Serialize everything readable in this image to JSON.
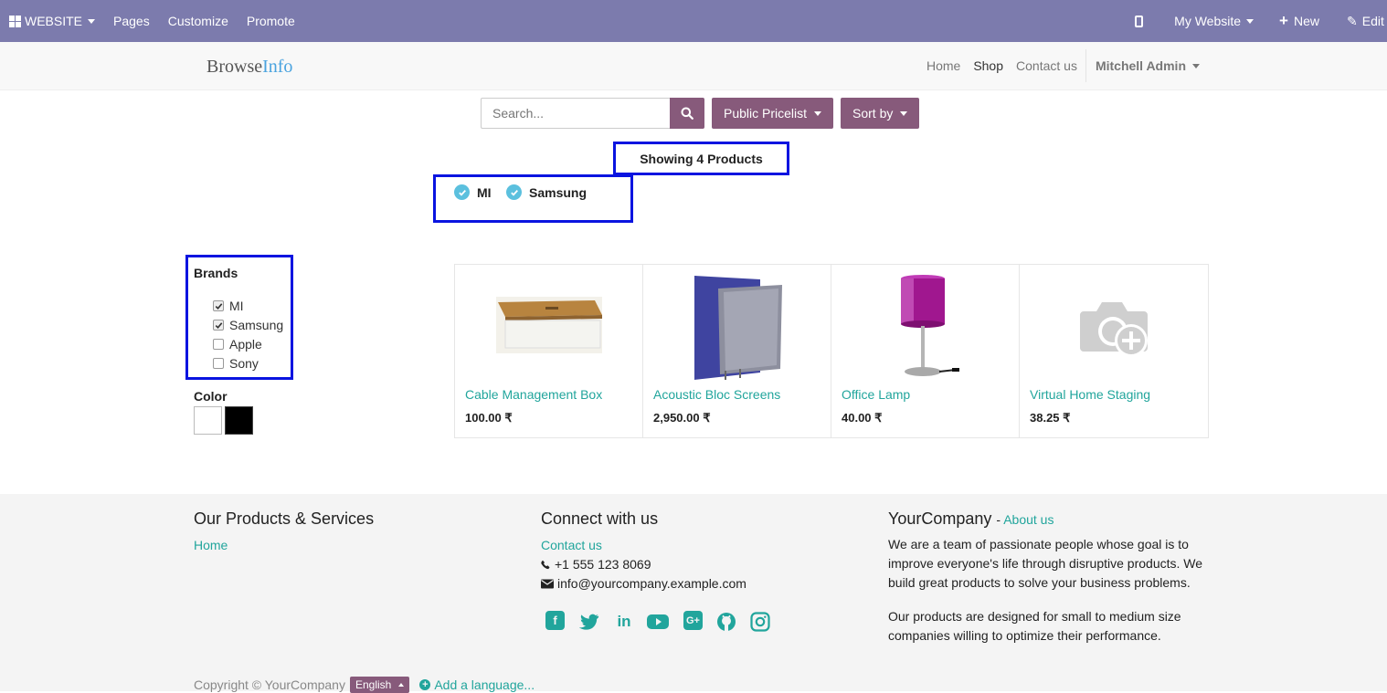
{
  "adminbar": {
    "app_label": "WEBSITE",
    "menu": [
      "Pages",
      "Customize",
      "Promote"
    ],
    "website_label": "My Website",
    "new_label": "New",
    "edit_label": "Edit"
  },
  "sitenav": {
    "brand_part1": "Browse",
    "brand_part2": "Info",
    "links": [
      "Home",
      "Shop",
      "Contact us"
    ],
    "user": "Mitchell Admin"
  },
  "toolbar": {
    "search_placeholder": "Search...",
    "pricelist_label": "Public Pricelist",
    "sort_label": "Sort by"
  },
  "results": {
    "showing_text": "Showing 4 Products",
    "active_filters": [
      "MI",
      "Samsung"
    ]
  },
  "filters": {
    "brands_title": "Brands",
    "brands": [
      {
        "label": "MI",
        "checked": true
      },
      {
        "label": "Samsung",
        "checked": true
      },
      {
        "label": "Apple",
        "checked": false
      },
      {
        "label": "Sony",
        "checked": false
      }
    ],
    "color_title": "Color",
    "colors": [
      "#ffffff",
      "#000000"
    ]
  },
  "products": [
    {
      "name": "Cable Management Box",
      "price": "100.00 ₹"
    },
    {
      "name": "Acoustic Bloc Screens",
      "price": "2,950.00 ₹"
    },
    {
      "name": "Office Lamp",
      "price": "40.00 ₹"
    },
    {
      "name": "Virtual Home Staging",
      "price": "38.25 ₹"
    }
  ],
  "footer": {
    "col1_title": "Our Products & Services",
    "col1_link": "Home",
    "col2_title": "Connect with us",
    "col2_link": "Contact us",
    "phone": "+1 555 123 8069",
    "email": "info@yourcompany.example.com",
    "social_icons": [
      "facebook-icon",
      "twitter-icon",
      "linkedin-icon",
      "youtube-icon",
      "google-plus-icon",
      "github-icon",
      "instagram-icon"
    ],
    "col3_title": "YourCompany",
    "col3_about": "About us",
    "col3_text1": "We are a team of passionate people whose goal is to improve everyone's life through disruptive products. We build great products to solve your business problems.",
    "col3_text2": "Our products are designed for small to medium size companies willing to optimize their performance.",
    "copyright": "Copyright © YourCompany",
    "language": "English",
    "add_language": "Add a language..."
  },
  "colors": {
    "admin_bar": "#7c7bad",
    "primary": "#875a7b",
    "link": "#21a59c",
    "highlight": "#0a14e0"
  }
}
